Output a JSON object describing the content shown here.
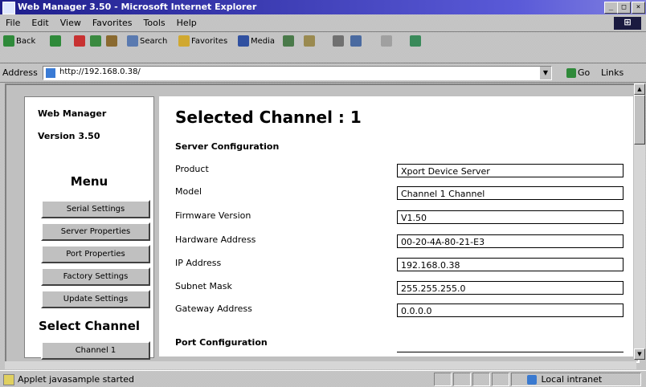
{
  "window": {
    "title": "Web Manager 3.50 - Microsoft Internet Explorer"
  },
  "menubar": [
    "File",
    "Edit",
    "View",
    "Favorites",
    "Tools",
    "Help"
  ],
  "toolbar": {
    "back": "Back",
    "search": "Search",
    "favorites": "Favorites",
    "media": "Media"
  },
  "address": {
    "label": "Address",
    "url": "http://192.168.0.38/",
    "go": "Go",
    "links": "Links"
  },
  "leftpanel": {
    "app_name": "Web Manager",
    "version": "Version 3.50",
    "menu_title": "Menu",
    "buttons": [
      "Serial Settings",
      "Server Properties",
      "Port Properties",
      "Factory Settings",
      "Update Settings"
    ],
    "select_channel_title": "Select Channel",
    "channel_button": "Channel 1"
  },
  "main": {
    "heading": "Selected Channel : 1",
    "server_config_title": "Server Configuration",
    "fields": [
      {
        "label": "Product",
        "value": "Xport Device Server"
      },
      {
        "label": "Model",
        "value": "Channel 1 Channel"
      },
      {
        "label": "Firmware Version",
        "value": "V1.50"
      },
      {
        "label": "Hardware Address",
        "value": "00-20-4A-80-21-E3"
      },
      {
        "label": "IP Address",
        "value": "192.168.0.38"
      },
      {
        "label": "Subnet Mask",
        "value": "255.255.255.0"
      },
      {
        "label": "Gateway Address",
        "value": "0.0.0.0"
      }
    ],
    "port_config_title": "Port Configuration"
  },
  "statusbar": {
    "status": "Applet javasample started",
    "zone": "Local intranet"
  }
}
